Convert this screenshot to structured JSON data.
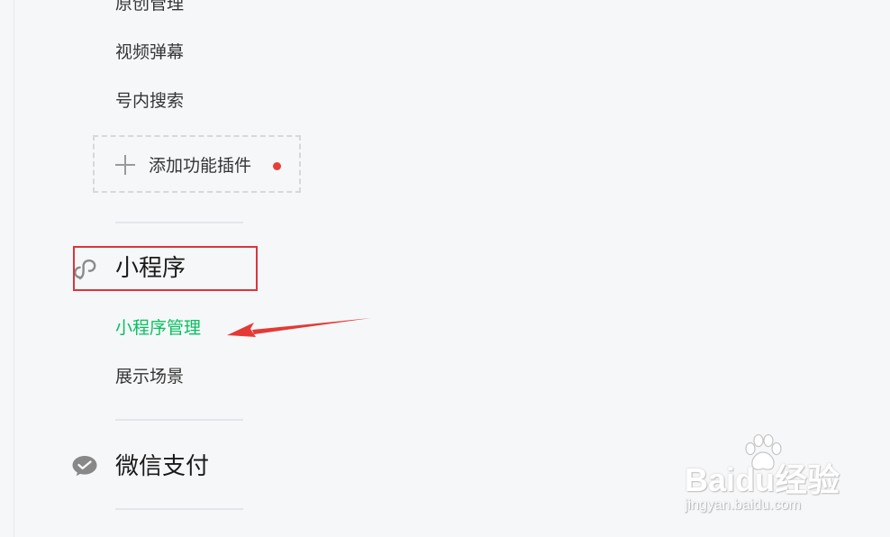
{
  "nav": {
    "items_top": [
      {
        "label": "原创管理"
      },
      {
        "label": "视频弹幕"
      },
      {
        "label": "号内搜索"
      }
    ],
    "add_plugin": {
      "label": "添加功能插件",
      "icon": "plus-icon",
      "badge": "red-dot"
    },
    "mini_program": {
      "title": "小程序",
      "icon": "mini-program-icon",
      "items": [
        {
          "label": "小程序管理",
          "active": true
        },
        {
          "label": "展示场景",
          "active": false
        }
      ]
    },
    "wechat_pay": {
      "title": "微信支付",
      "icon": "wechat-pay-icon"
    }
  },
  "watermark": {
    "brand": "Baidu经验",
    "url": "jingyan.baidu.com"
  },
  "colors": {
    "active": "#07c160",
    "annotation_red": "#d9363e",
    "badge_red": "#e6403a",
    "background": "#f6f7f9"
  }
}
